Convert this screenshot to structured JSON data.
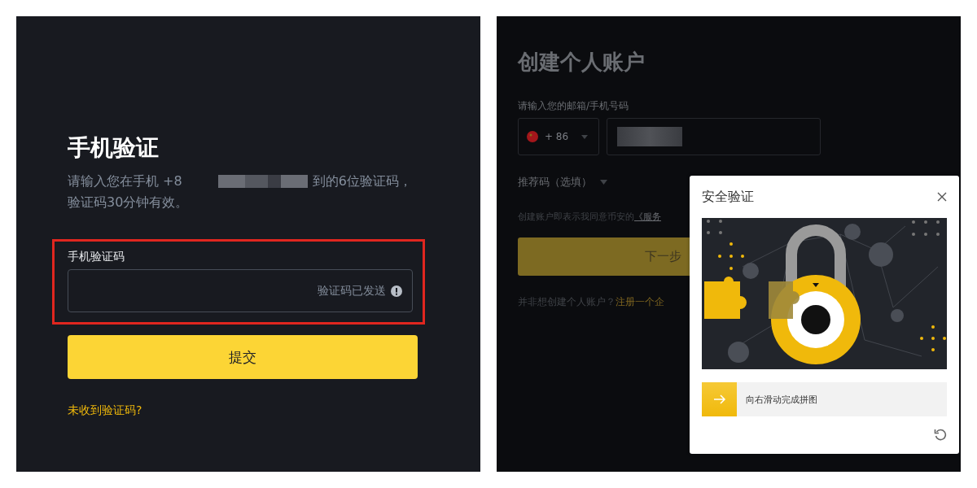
{
  "verify_panel": {
    "title": "手机验证",
    "description": {
      "before": "请输入您在手机 +8",
      "after": "到的6位验证码，",
      "line2": "验证码30分钟有效。"
    },
    "code_field": {
      "label": "手机验证码",
      "status": "验证码已发送",
      "highlighted": true
    },
    "submit_button": "提交",
    "resend_link": "未收到验证码?"
  },
  "signup_panel": {
    "title": "创建个人账户",
    "contact_label": "请输入您的邮箱/手机号码",
    "country_code": "+ 86",
    "referral_label": "推荐码（选填）",
    "terms_text": "创建账户即表示我同意币安的",
    "terms_link": "《服务",
    "next_button": "下一步",
    "alt_text": "并非想创建个人账户？",
    "alt_link": "注册一个企"
  },
  "captcha": {
    "title": "安全验证",
    "slider": {
      "hint": "向右滑动完成拼图",
      "level": 0
    }
  }
}
